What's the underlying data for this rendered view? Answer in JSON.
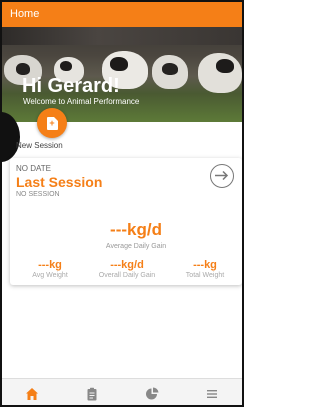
{
  "app": {
    "title": "Home"
  },
  "hero": {
    "greeting": "Hi Gerard!",
    "welcome": "Welcome to Animal Performance"
  },
  "new_session": {
    "label": "New Session"
  },
  "last_session": {
    "date": "NO DATE",
    "title": "Last Session",
    "session": "NO SESSION",
    "adg_value": "---kg/d",
    "adg_label": "Average Daily Gain",
    "metrics": [
      {
        "value": "---kg",
        "label": "Avg Weight"
      },
      {
        "value": "---kg/d",
        "label": "Overall Daily Gain"
      },
      {
        "value": "---kg",
        "label": "Total Weight"
      }
    ]
  },
  "nav": {
    "items": [
      {
        "icon": "home-icon",
        "active": true
      },
      {
        "icon": "clipboard-icon",
        "active": false
      },
      {
        "icon": "pie-chart-icon",
        "active": false
      },
      {
        "icon": "menu-icon",
        "active": false
      }
    ]
  },
  "colors": {
    "accent": "#f57f17",
    "muted_icon": "#888888"
  }
}
